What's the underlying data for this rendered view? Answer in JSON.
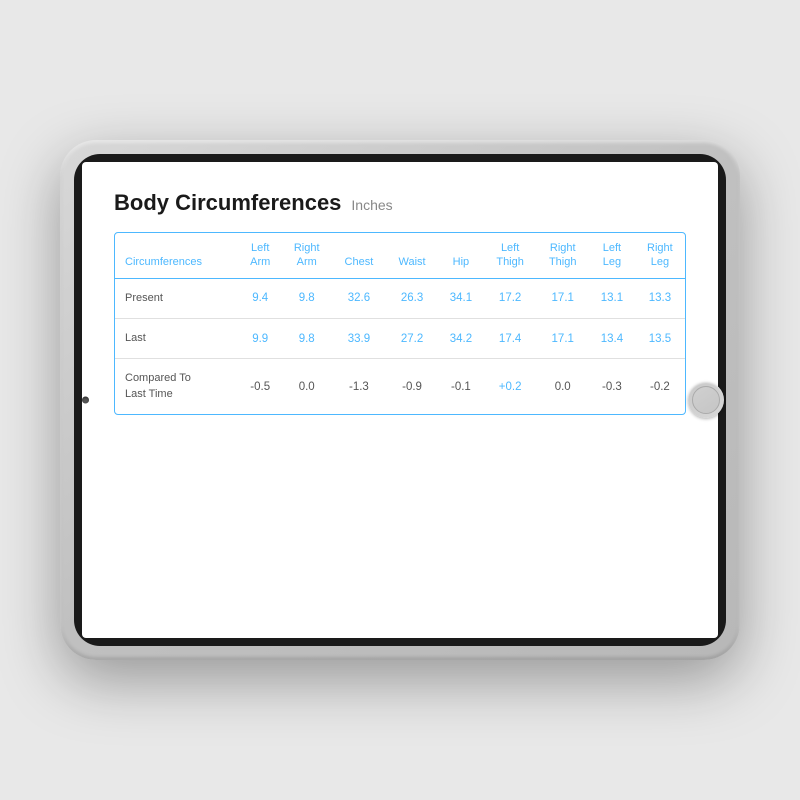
{
  "tablet": {
    "title": "Body Circumferences",
    "subtitle": "Inches",
    "table": {
      "headers": [
        {
          "id": "label",
          "lines": [
            "Circumferences"
          ]
        },
        {
          "id": "left_arm",
          "lines": [
            "Left",
            "Arm"
          ]
        },
        {
          "id": "right_arm",
          "lines": [
            "Right",
            "Arm"
          ]
        },
        {
          "id": "chest",
          "lines": [
            "Chest"
          ]
        },
        {
          "id": "waist",
          "lines": [
            "Waist"
          ]
        },
        {
          "id": "hip",
          "lines": [
            "Hip"
          ]
        },
        {
          "id": "left_thigh",
          "lines": [
            "Left",
            "Thigh"
          ]
        },
        {
          "id": "right_thigh",
          "lines": [
            "Right",
            "Thigh"
          ]
        },
        {
          "id": "left_leg",
          "lines": [
            "Left",
            "Leg"
          ]
        },
        {
          "id": "right_leg",
          "lines": [
            "Right",
            "Leg"
          ]
        }
      ],
      "rows": [
        {
          "label": "Present",
          "values": [
            "9.4",
            "9.8",
            "32.6",
            "26.3",
            "34.1",
            "17.2",
            "17.1",
            "13.1",
            "13.3"
          ]
        },
        {
          "label": "Last",
          "values": [
            "9.9",
            "9.8",
            "33.9",
            "27.2",
            "34.2",
            "17.4",
            "17.1",
            "13.4",
            "13.5"
          ]
        },
        {
          "label": "Compared To\nLast Time",
          "values": [
            "-0.5",
            "0.0",
            "-1.3",
            "-0.9",
            "-0.1",
            "+0.2",
            "0.0",
            "-0.3",
            "-0.2"
          ]
        }
      ]
    }
  }
}
